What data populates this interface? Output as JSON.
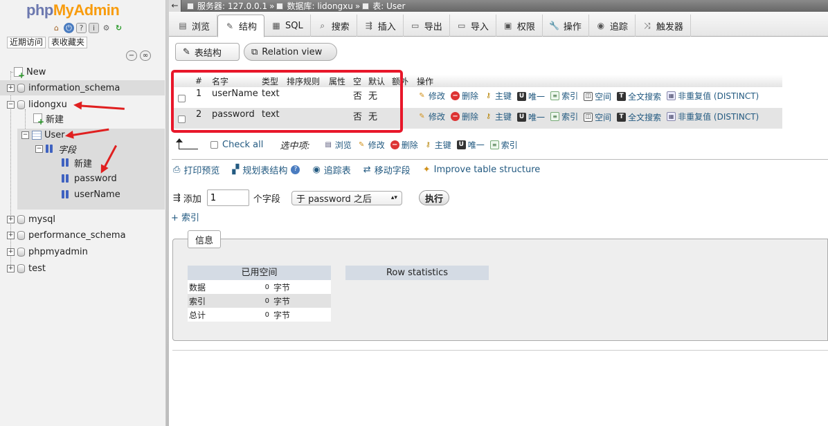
{
  "nav": {
    "logo_php": "php",
    "logo_my": "My",
    "logo_admin": "Admin",
    "tabs": [
      "近期访问",
      "表收藏夹"
    ],
    "items": {
      "new": "New",
      "info_schema": "information_schema",
      "lidongxu": "lidongxu",
      "lidongxu_new": "新建",
      "user": "User",
      "fields": "字段",
      "fields_new": "新建",
      "col_password": "password",
      "col_username": "userName",
      "mysql": "mysql",
      "perf_schema": "performance_schema",
      "phpmyadmin": "phpmyadmin",
      "test": "test"
    }
  },
  "topbar": {
    "server": "服务器: 127.0.0.1",
    "database": "数据库: lidongxu",
    "table": "表: User",
    "sep": "»"
  },
  "menu": [
    "浏览",
    "结构",
    "SQL",
    "搜索",
    "插入",
    "导出",
    "导入",
    "权限",
    "操作",
    "追踪",
    "触发器"
  ],
  "subtabs": {
    "structure": "表结构",
    "relation": "Relation view"
  },
  "structure": {
    "headers": [
      "#",
      "名字",
      "类型",
      "排序规则",
      "属性",
      "空",
      "默认",
      "额外",
      "操作"
    ],
    "rows": [
      {
        "num": "1",
        "name": "userName",
        "type": "text",
        "null": "否",
        "default": "无"
      },
      {
        "num": "2",
        "name": "password",
        "type": "text",
        "null": "否",
        "default": "无"
      }
    ],
    "actions": [
      "修改",
      "删除",
      "主键",
      "唯一",
      "索引",
      "空间",
      "全文搜索",
      "非重复值 (DISTINCT)"
    ]
  },
  "with_selected": {
    "check_all": "Check all",
    "label": "选中项:",
    "actions": [
      "浏览",
      "修改",
      "删除",
      "主键",
      "唯一",
      "索引"
    ]
  },
  "links": [
    "打印预览",
    "规划表结构",
    "追踪表",
    "移动字段",
    "Improve table structure"
  ],
  "add": {
    "label": "添加",
    "count": "1",
    "unit": "个字段",
    "position": "于 password 之后",
    "go": "执行",
    "index": "+ 索引"
  },
  "info": {
    "legend": "信息",
    "space_title": "已用空间",
    "rows": [
      {
        "key": "数据",
        "value": "0",
        "unit": "字节"
      },
      {
        "key": "索引",
        "value": "0",
        "unit": "字节"
      },
      {
        "key": "总计",
        "value": "0",
        "unit": "字节"
      }
    ],
    "row_stats": "Row statistics"
  },
  "colors": {
    "annotation": "#e8172a",
    "link": "#235a81",
    "logo_blue": "#6c78af",
    "logo_orange": "#f89c0e"
  }
}
